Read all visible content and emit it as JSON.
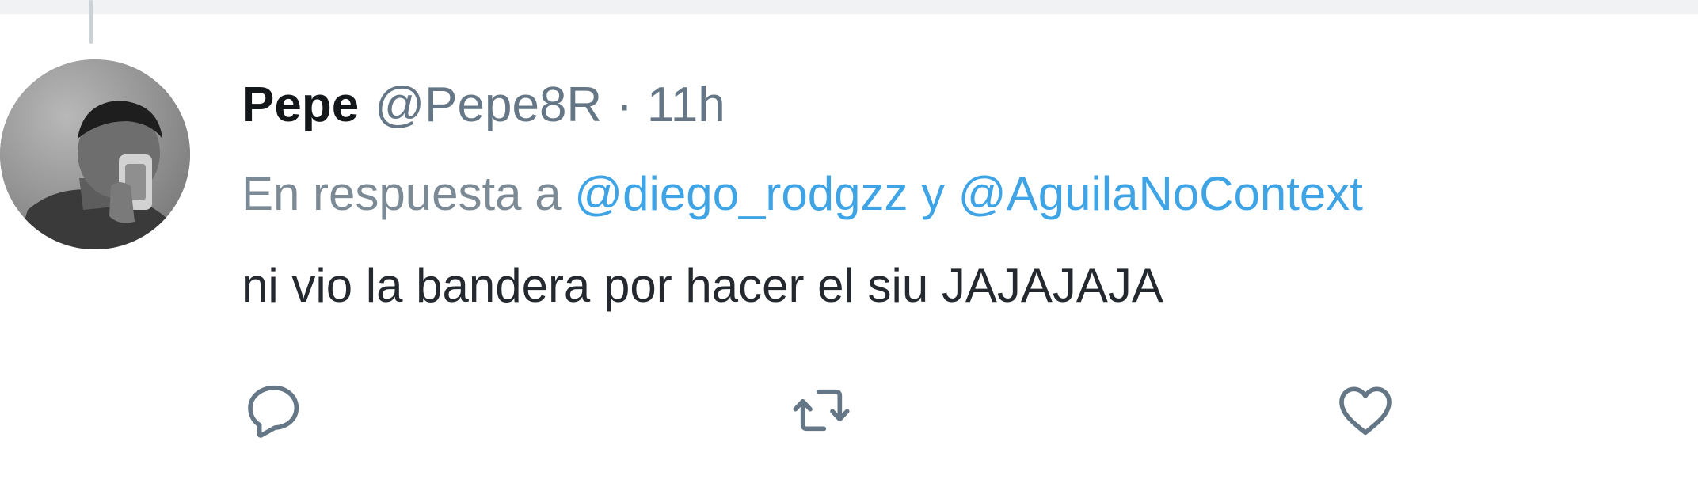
{
  "tweet": {
    "display_name": "Pepe",
    "handle": "@Pepe8R",
    "separator": "·",
    "time": "11h",
    "reply_prefix": "En respuesta a",
    "reply_mentions": [
      "@diego_rodgzz",
      "@AguilaNoContext"
    ],
    "reply_conjunction": "y",
    "text": "ni vio la bandera por hacer el siu JAJAJAJA"
  },
  "actions": [
    {
      "name": "reply",
      "icon": "reply-icon"
    },
    {
      "name": "retweet",
      "icon": "retweet-icon"
    },
    {
      "name": "like",
      "icon": "heart-icon"
    }
  ],
  "colors": {
    "text": "#14171a",
    "secondary": "#657786",
    "link": "#3fa4e6",
    "icon": "#657786"
  }
}
